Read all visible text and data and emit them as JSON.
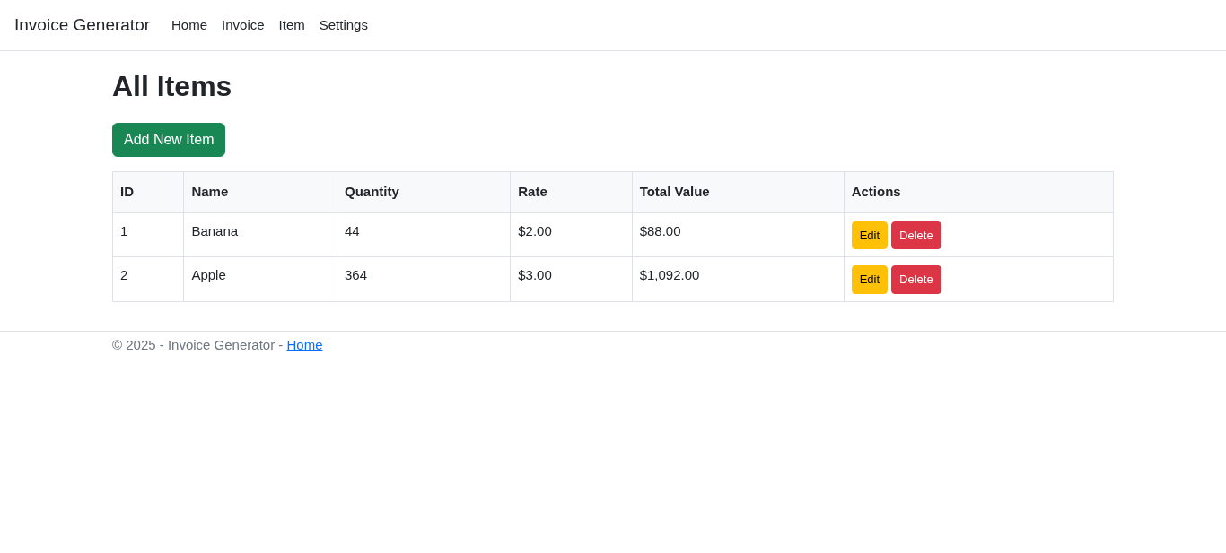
{
  "navbar": {
    "brand": "Invoice Generator",
    "links": [
      {
        "label": "Home"
      },
      {
        "label": "Invoice"
      },
      {
        "label": "Item"
      },
      {
        "label": "Settings"
      }
    ]
  },
  "page_title": "All Items",
  "add_button": "Add New Item",
  "table": {
    "columns": [
      "ID",
      "Name",
      "Quantity",
      "Rate",
      "Total Value",
      "Actions"
    ],
    "rows": [
      {
        "cells": [
          "1",
          "Banana",
          "44",
          "$2.00",
          "$88.00"
        ],
        "actions": [
          {
            "kind": "edit",
            "label": "Edit"
          },
          {
            "kind": "delete",
            "label": "Delete"
          }
        ]
      },
      {
        "cells": [
          "2",
          "Apple",
          "364",
          "$3.00",
          "$1,092.00"
        ],
        "actions": [
          {
            "kind": "edit",
            "label": "Edit"
          },
          {
            "kind": "delete",
            "label": "Delete"
          }
        ]
      }
    ]
  },
  "footer": {
    "text": "© 2025 - Invoice Generator - ",
    "link": "Home"
  }
}
